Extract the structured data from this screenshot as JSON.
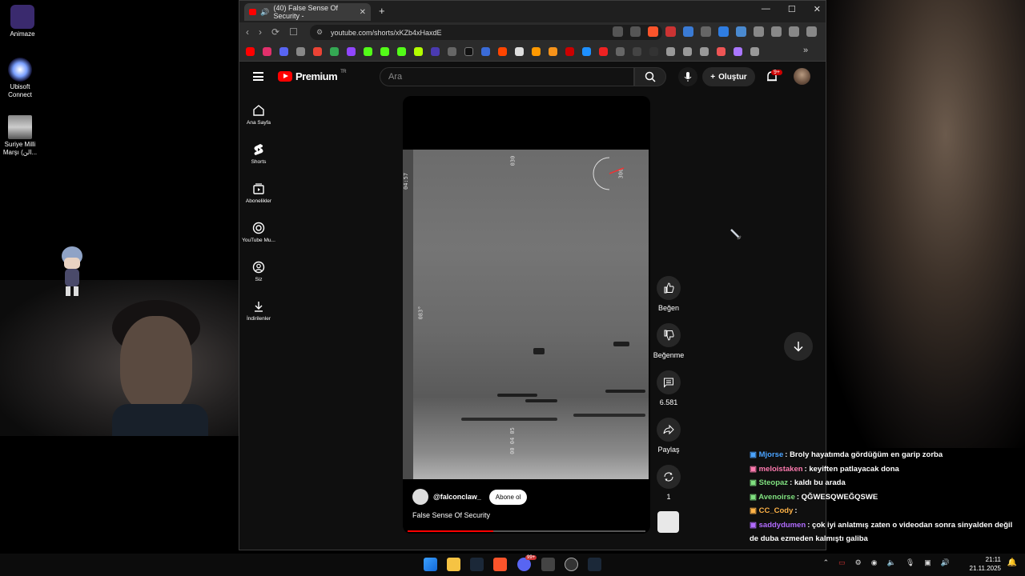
{
  "desktop": {
    "icons": [
      {
        "label": "Animaze"
      },
      {
        "label": "Ubisoft Connect"
      },
      {
        "label": "Suriye Milli Marşı (الن..."
      }
    ]
  },
  "browser": {
    "tab_title": "(40) False Sense Of Security -",
    "url": "youtube.com/shorts/xKZb4xHaxdE"
  },
  "youtube": {
    "logo": "Premium",
    "region": "TR",
    "search_placeholder": "Ara",
    "create_label": "Oluştur",
    "notif_badge": "9+",
    "sidebar": [
      {
        "label": "Ana Sayfa",
        "icon": "home-icon"
      },
      {
        "label": "Shorts",
        "icon": "shorts-icon"
      },
      {
        "label": "Abonelikler",
        "icon": "subscriptions-icon"
      },
      {
        "label": "YouTube Mu...",
        "icon": "youtube-music-icon"
      },
      {
        "label": "Siz",
        "icon": "user-icon"
      },
      {
        "label": "İndirilenler",
        "icon": "download-icon"
      }
    ],
    "short": {
      "channel": "@falconclaw_",
      "subscribe": "Abone ol",
      "title": "False Sense Of Security",
      "progress": 0.36,
      "osd": {
        "heading": "083°",
        "time": "00 04 05",
        "side_time": "04:57",
        "compass_top": "030",
        "compass_right": "300"
      }
    },
    "actions": {
      "like": "Beğen",
      "dislike": "Beğenme",
      "comments": "6.581",
      "share": "Paylaş",
      "remix": "1"
    }
  },
  "chat": [
    {
      "user": "Mjorse",
      "color": "#4aa3ff",
      "msg": "Broly hayatımda gördüğüm en garip zorba"
    },
    {
      "user": "meloistaken",
      "color": "#ff7bb0",
      "msg": "keyiften patlayacak dona"
    },
    {
      "user": "Steopaz",
      "color": "#7fe07f",
      "msg": "kaldı bu arada"
    },
    {
      "user": "Avenoirse",
      "color": "#7fe07f",
      "msg": "QĞWESQWEĞQSWE"
    },
    {
      "user": "CC_Cody",
      "color": "#ffb347",
      "msg": ""
    },
    {
      "user": "saddydumen",
      "color": "#b16bff",
      "msg": "çok iyi anlatmış zaten o videodan sonra sinyalden değil"
    },
    {
      "user": "",
      "color": "#ffffff",
      "msg": "de duba ezmeden kalmıştı galiba"
    }
  ],
  "taskbar": {
    "time": "21:11",
    "date": "21.11.2025",
    "discord_badge": "99+"
  }
}
